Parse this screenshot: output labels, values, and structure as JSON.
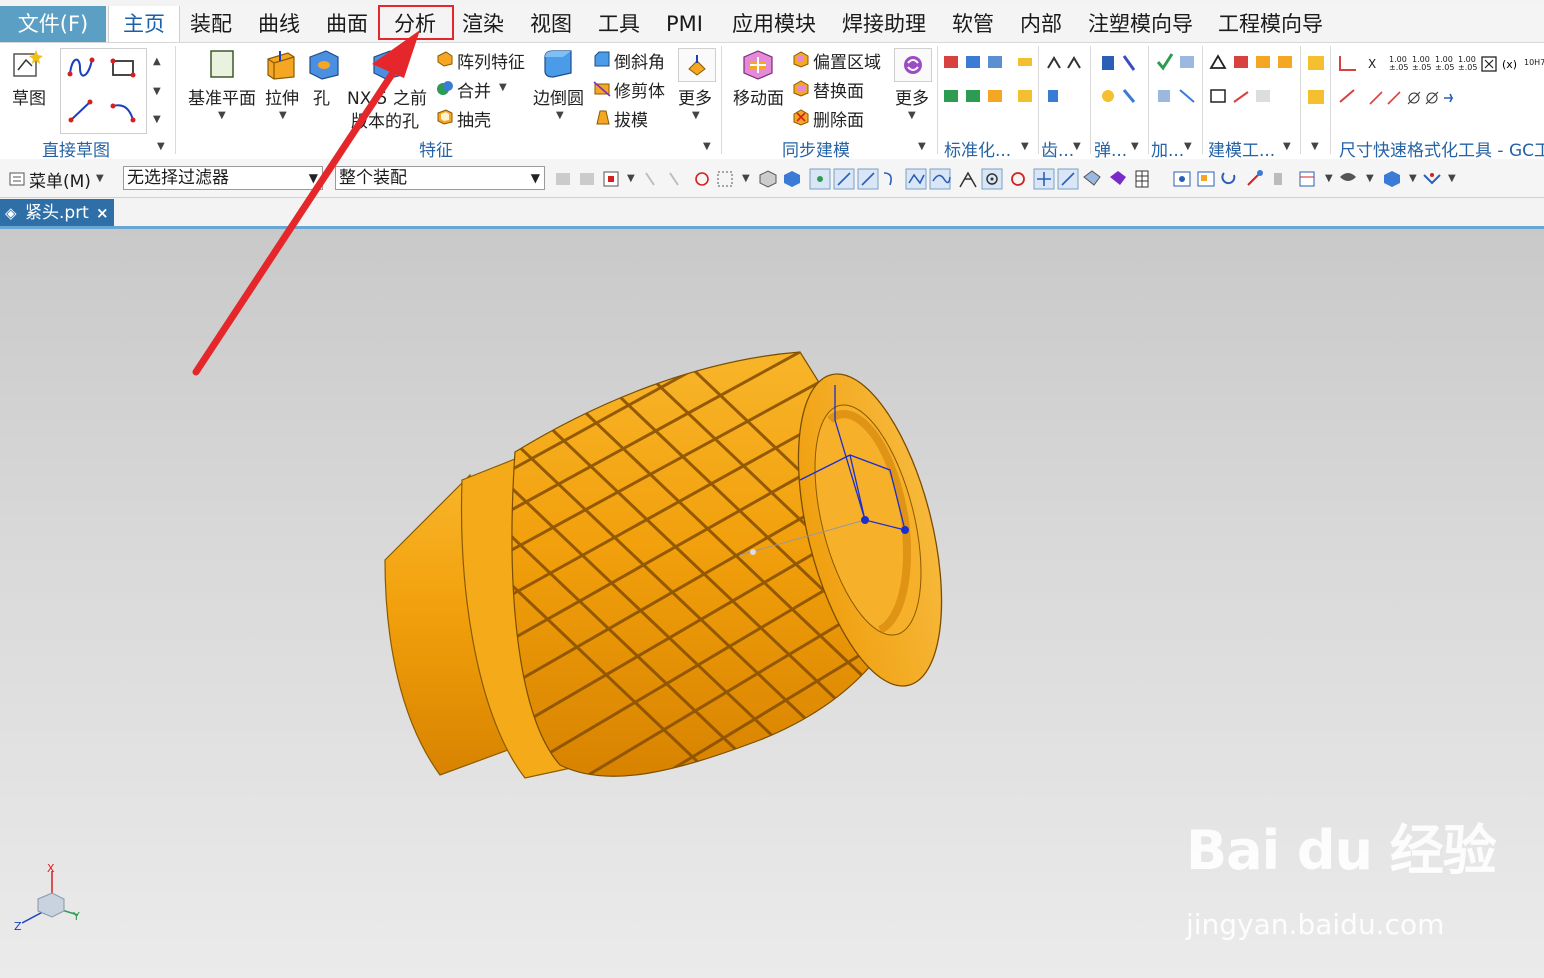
{
  "menu": {
    "file": "文件(F)",
    "tabs": [
      "主页",
      "装配",
      "曲线",
      "曲面",
      "分析",
      "渲染",
      "视图",
      "工具",
      "PMI",
      "应用模块",
      "焊接助理",
      "软管",
      "内部",
      "注塑模向导",
      "工程模向导"
    ]
  },
  "ribbon": {
    "sketch": {
      "label": "草图",
      "group": "直接草图"
    },
    "feature": {
      "datum_plane": "基准平面",
      "extrude": "拉伸",
      "hole": "孔",
      "nx5_hole_line1": "NX 5 之前",
      "nx5_hole_line2": "版本的孔",
      "pattern": "阵列特征",
      "unite": "合并",
      "shell": "抽壳",
      "edge_blend": "边倒圆",
      "chamfer": "倒斜角",
      "trim_body": "修剪体",
      "draft": "拔模",
      "more": "更多",
      "group": "特征"
    },
    "sync": {
      "move_face": "移动面",
      "offset_region": "偏置区域",
      "replace_face": "替换面",
      "delete_face": "删除面",
      "more": "更多",
      "group": "同步建模"
    },
    "groups_right": [
      "标准化...",
      "齿...",
      "弹...",
      "加...",
      "建模工...",
      "尺寸快速格式化工具 - GC工"
    ],
    "gc_tools": [
      "X",
      "1.00 ±.05",
      "1.00 ±.05",
      "1.00 ±.05",
      "1.00 ±.05",
      "10H7"
    ]
  },
  "toolbar": {
    "menu": "菜单(M)",
    "filter": "无选择过滤器",
    "scope": "整个装配"
  },
  "document": {
    "tab": "紧头.prt"
  },
  "axes": {
    "x": "X",
    "y": "Y",
    "z": "Z"
  },
  "watermark": {
    "logo": "Bai du 经验",
    "url": "jingyan.baidu.com"
  },
  "colors": {
    "accent_red": "#e5262a",
    "part_orange": "#f5a20a",
    "file_tab": "#5b9fc4"
  }
}
